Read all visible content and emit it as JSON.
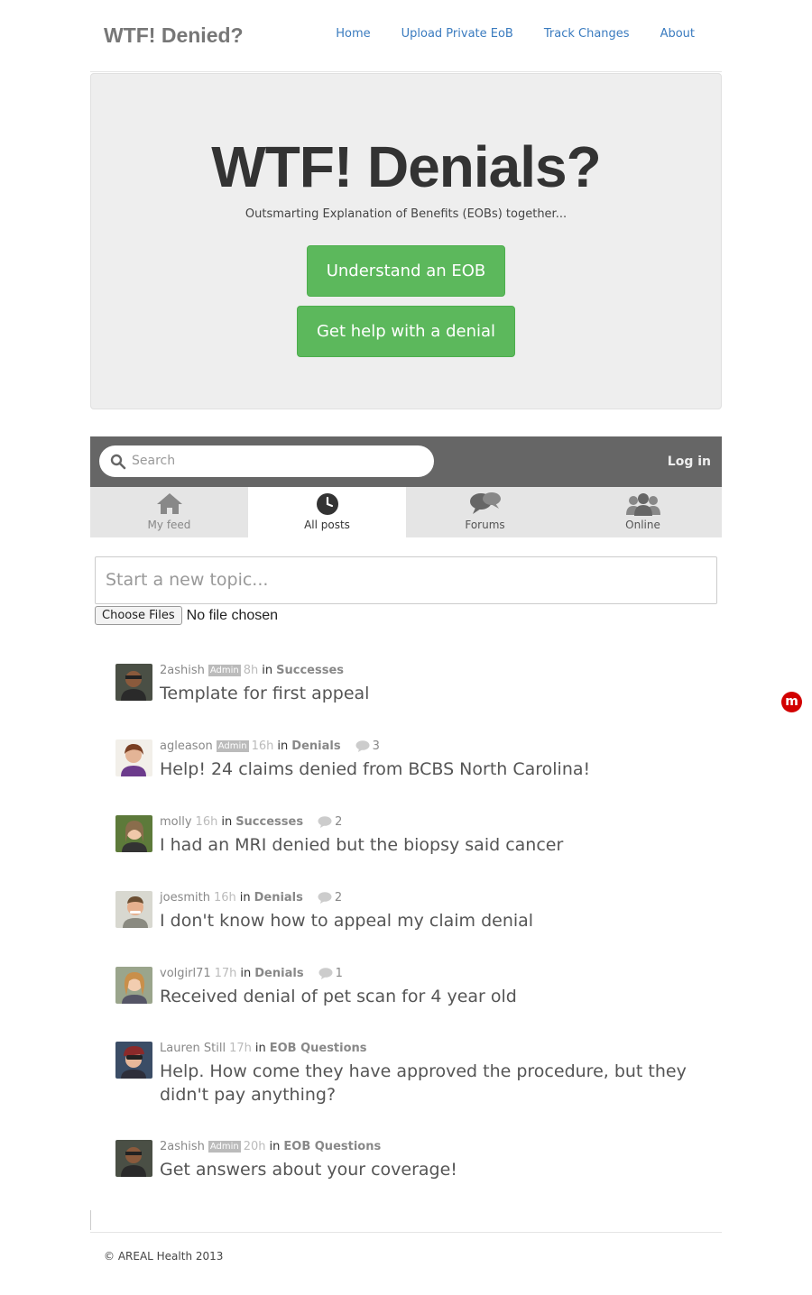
{
  "nav": {
    "brand": "WTF! Denied?",
    "links": [
      "Home",
      "Upload Private EoB",
      "Track Changes",
      "About"
    ]
  },
  "hero": {
    "title": "WTF! Denials?",
    "subtitle": "Outsmarting Explanation of Benefits (EOBs) together...",
    "btn_eob": "Understand an EOB",
    "btn_denial": "Get help with a denial"
  },
  "widget": {
    "search_placeholder": "Search",
    "login": "Log in",
    "tabs": [
      {
        "label": "My feed",
        "icon": "home-icon"
      },
      {
        "label": "All posts",
        "icon": "clock-icon"
      },
      {
        "label": "Forums",
        "icon": "speech-bubbles-icon"
      },
      {
        "label": "Online",
        "icon": "people-icon"
      }
    ],
    "new_topic_placeholder": "Start a new topic...",
    "choose_files": "Choose Files",
    "no_file": "No file chosen"
  },
  "posts": [
    {
      "user": "2ashish",
      "badge": "Admin",
      "time": "8h",
      "in": "in",
      "forum": "Successes",
      "comments": "",
      "title": "Template for first appeal"
    },
    {
      "user": "agleason",
      "badge": "Admin",
      "time": "16h",
      "in": "in",
      "forum": "Denials",
      "comments": "3",
      "title": "Help! 24 claims denied from BCBS North Carolina!"
    },
    {
      "user": "molly",
      "badge": "",
      "time": "16h",
      "in": "in",
      "forum": "Successes",
      "comments": "2",
      "title": "I had an MRI denied but the biopsy said cancer"
    },
    {
      "user": "joesmith",
      "badge": "",
      "time": "16h",
      "in": "in",
      "forum": "Denials",
      "comments": "2",
      "title": "I don't know how to appeal my claim denial"
    },
    {
      "user": "volgirl71",
      "badge": "",
      "time": "17h",
      "in": "in",
      "forum": "Denials",
      "comments": "1",
      "title": "Received denial of pet scan for 4 year old"
    },
    {
      "user": "Lauren Still",
      "badge": "",
      "time": "17h",
      "in": "in",
      "forum": "EOB Questions",
      "comments": "",
      "title": "Help. How come they have approved the procedure, but they didn't pay anything?"
    },
    {
      "user": "2ashish",
      "badge": "Admin",
      "time": "20h",
      "in": "in",
      "forum": "EOB Questions",
      "comments": "",
      "title": "Get answers about your coverage!"
    }
  ],
  "footer": "© AREAL Health 2013",
  "floating_badge": "m"
}
